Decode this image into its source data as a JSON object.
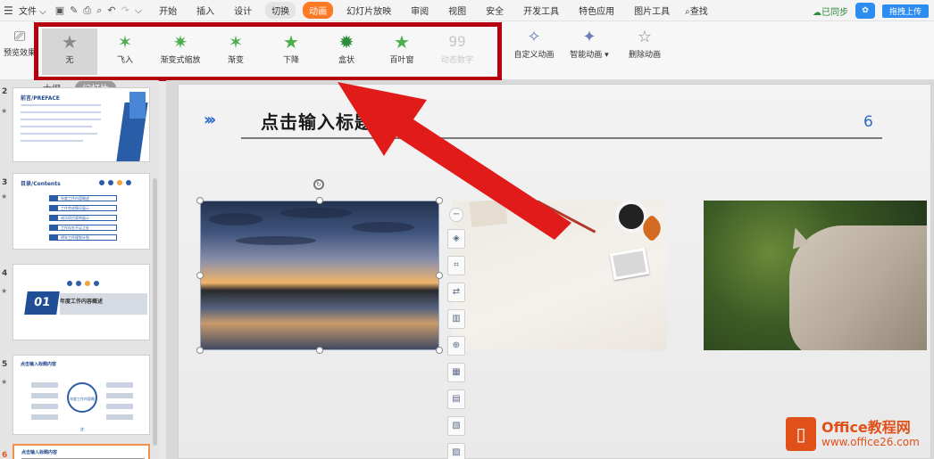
{
  "menubar": {
    "file_label": "文件",
    "tabs": [
      {
        "label": "开始",
        "style": ""
      },
      {
        "label": "插入",
        "style": ""
      },
      {
        "label": "设计",
        "style": ""
      },
      {
        "label": "切换",
        "style": "pill"
      },
      {
        "label": "动画",
        "style": "active"
      },
      {
        "label": "幻灯片放映",
        "style": ""
      },
      {
        "label": "审阅",
        "style": ""
      },
      {
        "label": "视图",
        "style": ""
      },
      {
        "label": "安全",
        "style": ""
      },
      {
        "label": "开发工具",
        "style": ""
      },
      {
        "label": "特色应用",
        "style": ""
      },
      {
        "label": "图片工具",
        "style": ""
      }
    ],
    "search_label": "查找",
    "sync_label": "已同步",
    "upload_label": "拖拽上传"
  },
  "ribbon": {
    "preview_label": "预览效果",
    "effects": [
      {
        "label": "无",
        "color": "#8a8a8a",
        "selected": true
      },
      {
        "label": "飞入",
        "color": "#4cae4c"
      },
      {
        "label": "渐变式缩放",
        "color": "#4cae4c"
      },
      {
        "label": "渐变",
        "color": "#4cae4c"
      },
      {
        "label": "下降",
        "color": "#4cae4c"
      },
      {
        "label": "盒状",
        "color": "#2e8b3a"
      },
      {
        "label": "百叶窗",
        "color": "#4cae4c"
      },
      {
        "label": "动态数字",
        "color": "#c7c7c7",
        "disabled": true,
        "glyph": "99"
      }
    ],
    "custom_anim_label": "自定义动画",
    "smart_anim_label": "智能动画",
    "delete_anim_label": "删除动画"
  },
  "left_panel": {
    "tab_outline": "大纲",
    "tab_slides": "幻灯片",
    "slides": [
      {
        "num": "2",
        "title": "前言/PREFACE"
      },
      {
        "num": "3",
        "title": "目录/Contents",
        "rows": [
          "年度工作内容概述",
          "工作完成情况展示",
          "成功项目案例展示",
          "工作存在不足之处",
          "明年工作规划计划"
        ]
      },
      {
        "num": "4",
        "big": "01",
        "caption": "年度工作内容概述"
      },
      {
        "num": "5",
        "title": "点击输入标题内容",
        "center": "年度工作内容概述"
      },
      {
        "num": "6",
        "title": "点击输入标题内容",
        "current": true
      }
    ]
  },
  "slide": {
    "title": "点击输入标题内",
    "page_number": "6"
  },
  "watermark": {
    "brand": "Office教程网",
    "url": "www.office26.com"
  },
  "colors": {
    "accent": "#ff7a24",
    "highlight_frame": "#b5000f",
    "arrow": "#e11a1a"
  }
}
